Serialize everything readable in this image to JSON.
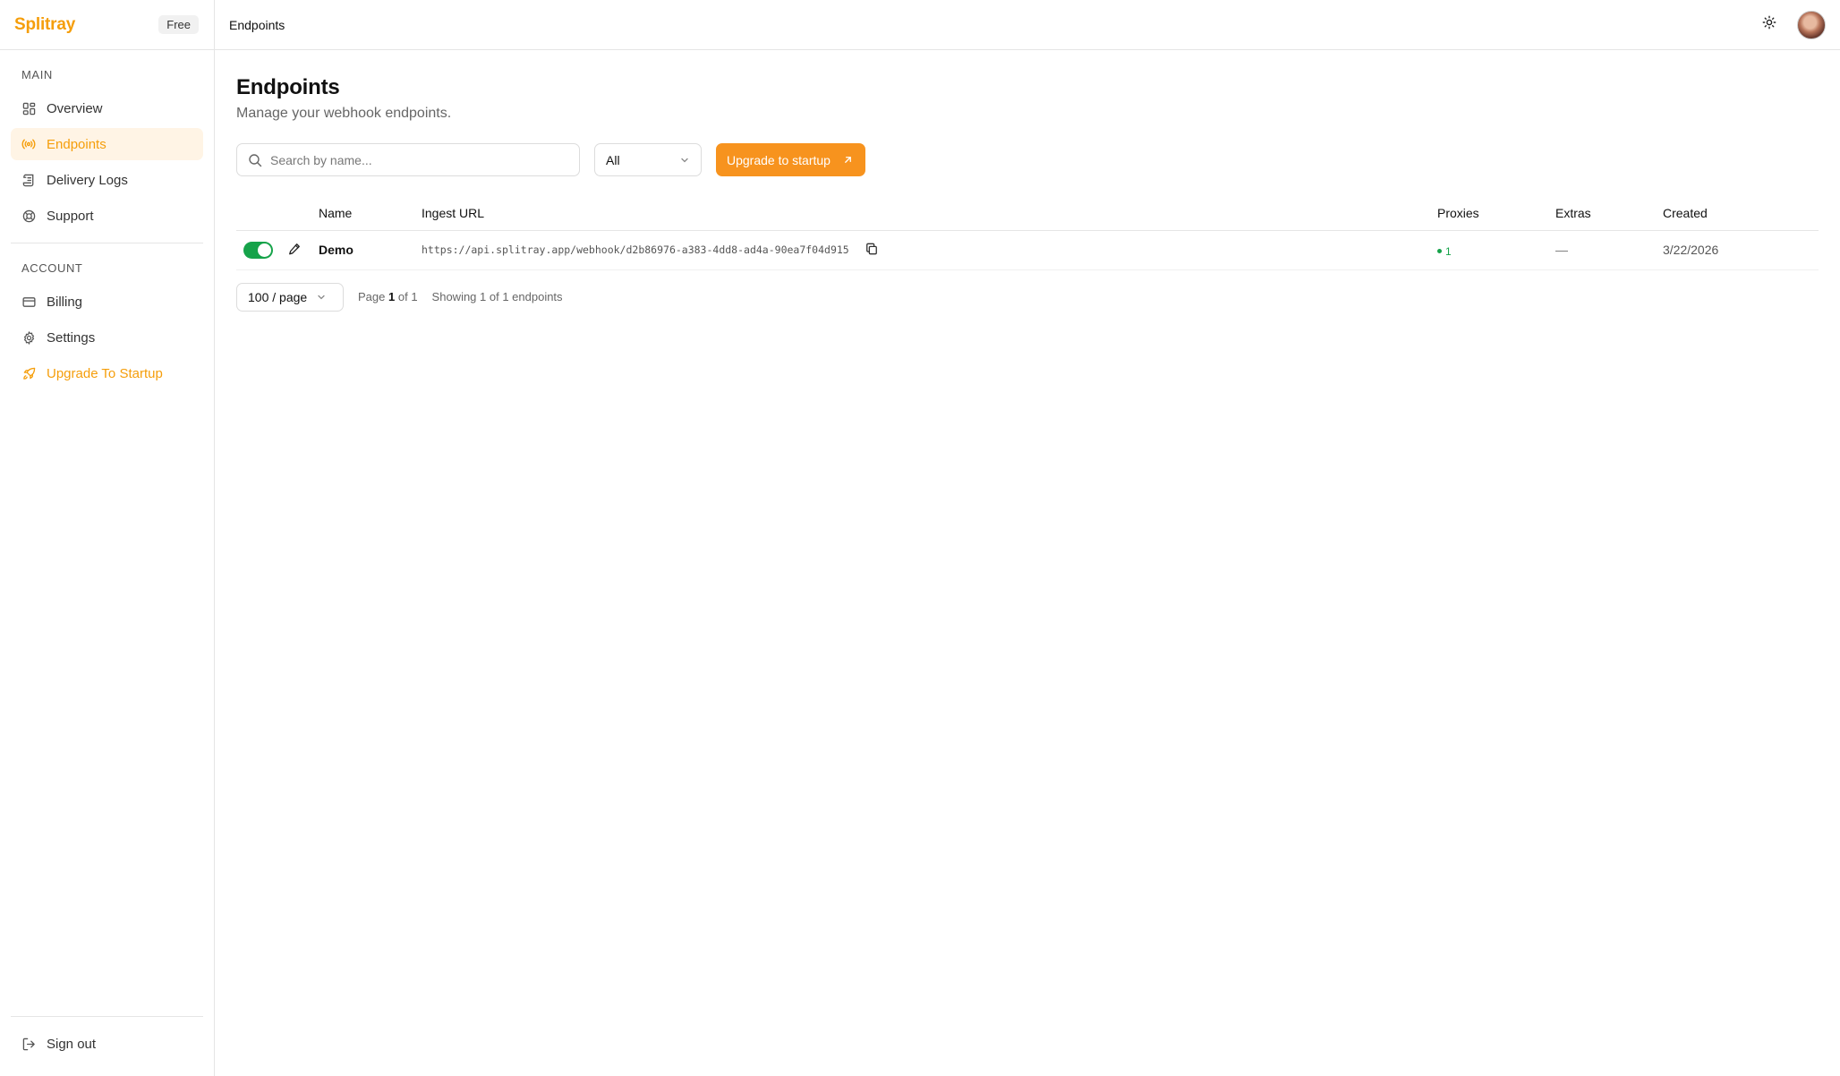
{
  "brand": {
    "name": "Splitray",
    "plan": "Free"
  },
  "sidebar": {
    "main_label": "MAIN",
    "main_items": [
      {
        "label": "Overview",
        "icon": "grid-icon"
      },
      {
        "label": "Endpoints",
        "icon": "broadcast-icon",
        "active": true
      },
      {
        "label": "Delivery Logs",
        "icon": "scroll-icon"
      },
      {
        "label": "Support",
        "icon": "lifebuoy-icon"
      }
    ],
    "account_label": "ACCOUNT",
    "account_items": [
      {
        "label": "Billing",
        "icon": "credit-card-icon"
      },
      {
        "label": "Settings",
        "icon": "gear-icon"
      },
      {
        "label": "Upgrade To Startup",
        "icon": "rocket-icon",
        "accent": true
      }
    ],
    "sign_out": "Sign out"
  },
  "header": {
    "breadcrumb": "Endpoints",
    "theme_icon": "sun-icon"
  },
  "page": {
    "title": "Endpoints",
    "subtitle": "Manage your webhook endpoints."
  },
  "toolbar": {
    "search_placeholder": "Search by name...",
    "filter_value": "All",
    "upgrade_label": "Upgrade to startup"
  },
  "table": {
    "columns": [
      "Name",
      "Ingest URL",
      "Proxies",
      "Extras",
      "Created"
    ],
    "rows": [
      {
        "enabled": true,
        "name": "Demo",
        "url": "https://api.splitray.app/webhook/d2b86976-a383-4dd8-ad4a-90ea7f04d915",
        "proxies": "1",
        "extras": "—",
        "created": "3/22/2026"
      }
    ]
  },
  "pagination": {
    "page_size": "100 / page",
    "page_prefix": "Page",
    "page_current": "1",
    "page_suffix": "of 1",
    "showing": "Showing 1 of 1 endpoints"
  },
  "colors": {
    "accent": "#f59e0b",
    "button": "#f7931e",
    "success": "#16a34a"
  }
}
